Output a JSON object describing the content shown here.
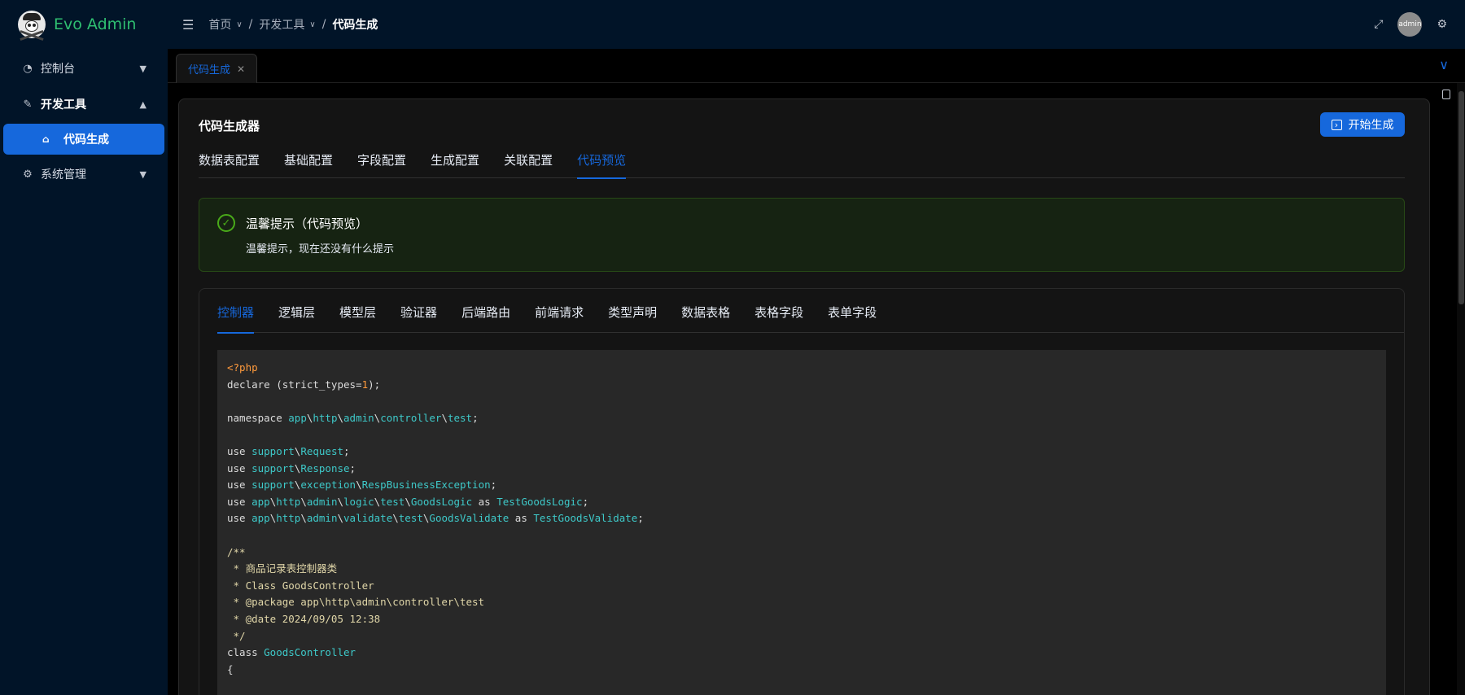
{
  "app": {
    "title": "Evo Admin"
  },
  "sidebar": {
    "items": [
      {
        "label": "控制台",
        "icon": "dashboard-icon",
        "expanded": false
      },
      {
        "label": "开发工具",
        "icon": "tool-icon",
        "expanded": true,
        "children": [
          {
            "label": "代码生成",
            "icon": "robot-icon",
            "active": true
          }
        ]
      },
      {
        "label": "系统管理",
        "icon": "gear-icon",
        "expanded": false
      }
    ]
  },
  "header": {
    "breadcrumb": [
      {
        "label": "首页"
      },
      {
        "label": "开发工具"
      },
      {
        "label": "代码生成"
      }
    ],
    "avatar_text": "admin"
  },
  "tabs": {
    "open": [
      {
        "label": "代码生成",
        "active": true
      }
    ]
  },
  "page": {
    "title": "代码生成器",
    "generate_button": "开始生成",
    "config_tabs": [
      "数据表配置",
      "基础配置",
      "字段配置",
      "生成配置",
      "关联配置",
      "代码预览"
    ],
    "active_config_tab": "代码预览",
    "alert": {
      "title": "温馨提示（代码预览）",
      "description": "温馨提示，现在还没有什么提示"
    },
    "code_tabs": [
      "控制器",
      "逻辑层",
      "模型层",
      "验证器",
      "后端路由",
      "前端请求",
      "类型声明",
      "数据表格",
      "表格字段",
      "表单字段"
    ],
    "active_code_tab": "控制器",
    "code_lines": [
      "<?php",
      "declare (strict_types=1);",
      "",
      "namespace app\\http\\admin\\controller\\test;",
      "",
      "use support\\Request;",
      "use support\\Response;",
      "use support\\exception\\RespBusinessException;",
      "use app\\http\\admin\\logic\\test\\GoodsLogic as TestGoodsLogic;",
      "use app\\http\\admin\\validate\\test\\GoodsValidate as TestGoodsValidate;",
      "",
      "/**",
      " * 商品记录表控制器类",
      " * Class GoodsController",
      " * @package app\\http\\admin\\controller\\test",
      " * @date 2024/09/05 12:38",
      " */",
      "class GoodsController",
      "{"
    ]
  },
  "colors": {
    "accent": "#1668dc",
    "brand": "#2fbf71",
    "success": "#49aa19"
  }
}
